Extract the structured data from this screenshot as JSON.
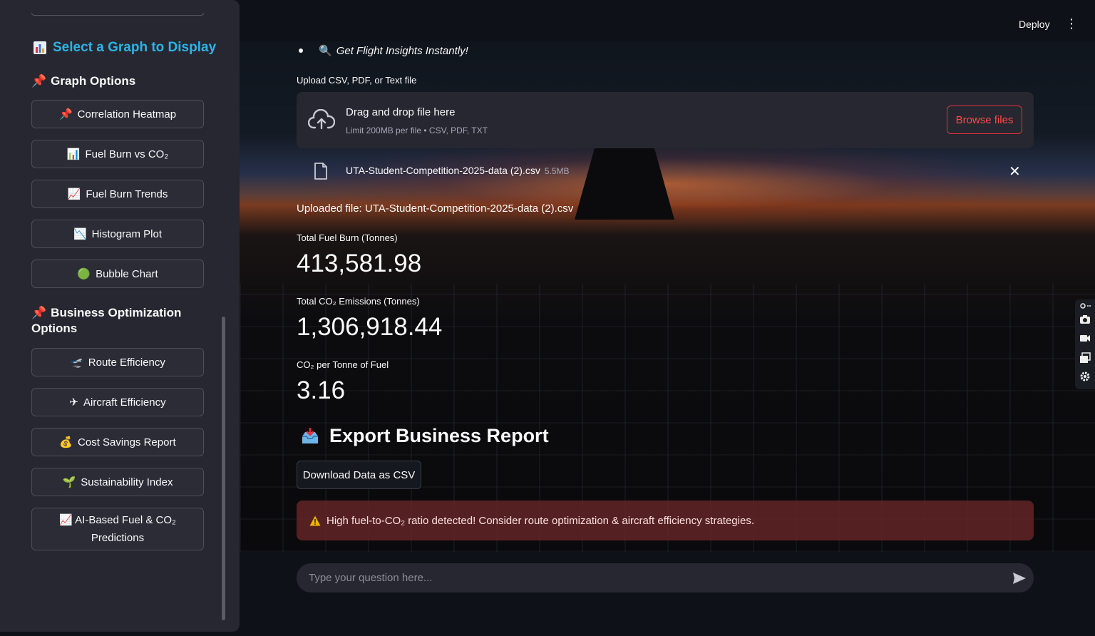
{
  "sidebar": {
    "title": "Select a Graph to Display",
    "title_icon": "bar-chart-icon",
    "graph_options_heading": "Graph Options",
    "graph_buttons": [
      {
        "icon": "📌",
        "label": "Correlation Heatmap"
      },
      {
        "icon": "📊",
        "label": "Fuel Burn vs CO₂"
      },
      {
        "icon": "📈",
        "label": "Fuel Burn Trends"
      },
      {
        "icon": "📉",
        "label": "Histogram Plot"
      },
      {
        "icon": "🟢",
        "label": "Bubble Chart"
      }
    ],
    "business_heading": "Business Optimization Options",
    "business_buttons": [
      {
        "icon": "🛫",
        "label": "Route Efficiency"
      },
      {
        "icon": "✈",
        "label": "Aircraft Efficiency"
      },
      {
        "icon": "💰",
        "label": "Cost Savings Report"
      },
      {
        "icon": "🌱",
        "label": "Sustainability Index"
      },
      {
        "icon": "📈",
        "label": "AI-Based Fuel & CO₂",
        "label2": "Predictions"
      }
    ]
  },
  "header": {
    "deploy_label": "Deploy",
    "menu_icon": "kebab-menu-icon"
  },
  "main": {
    "bullet_text": "Get Flight Insights Instantly!",
    "upload": {
      "label": "Upload CSV, PDF, or Text file",
      "drop_title": "Drag and drop file here",
      "drop_sub": "Limit 200MB per file • CSV, PDF, TXT",
      "browse_label": "Browse files"
    },
    "file": {
      "name": "UTA-Student-Competition-2025-data (2).csv",
      "size": "5.5MB"
    },
    "uploaded_msg": "Uploaded file: UTA-Student-Competition-2025-data (2).csv",
    "metrics": [
      {
        "label": "Total Fuel Burn (Tonnes)",
        "value": "413,581.98"
      },
      {
        "label": "Total CO₂ Emissions (Tonnes)",
        "value": "1,306,918.44"
      },
      {
        "label": "CO₂ per Tonne of Fuel",
        "value": "3.16"
      }
    ],
    "export_title": "Export Business Report",
    "download_label": "Download Data as CSV",
    "warning_text": "High fuel-to-CO₂ ratio detected! Consider route optimization & aircraft efficiency strategies.",
    "chat_placeholder": "Type your question here..."
  },
  "colors": {
    "accent": "#29b5e8",
    "danger": "#ff4b4b",
    "sidebar_bg": "#262730",
    "app_bg": "#0e1117"
  }
}
